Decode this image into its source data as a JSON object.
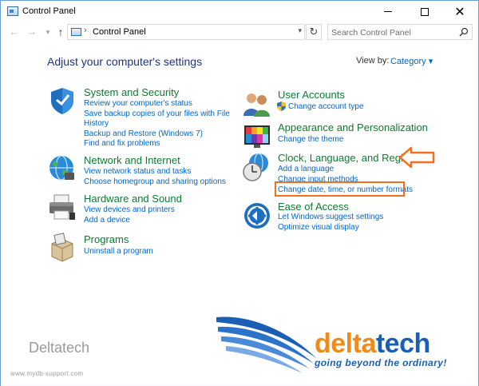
{
  "window": {
    "title": "Control Panel"
  },
  "addressbar": {
    "breadcrumb": "Control Panel",
    "separator": "›",
    "search_placeholder": "Search Control Panel"
  },
  "main": {
    "heading": "Adjust your computer's settings",
    "view_by_label": "View by:",
    "view_by_value": "Category ▾"
  },
  "categories": {
    "system": {
      "title": "System and Security",
      "links": [
        "Review your computer's status",
        "Save backup copies of your files with File",
        "History",
        "Backup and Restore (Windows 7)",
        "Find and fix problems"
      ]
    },
    "network": {
      "title": "Network and Internet",
      "links": [
        "View network status and tasks",
        "Choose homegroup and sharing options"
      ]
    },
    "hardware": {
      "title": "Hardware and Sound",
      "links": [
        "View devices and printers",
        "Add a device"
      ]
    },
    "programs": {
      "title": "Programs",
      "links": [
        "Uninstall a program"
      ]
    },
    "users": {
      "title": "User Accounts",
      "links": [
        "Change account type"
      ]
    },
    "appearance": {
      "title": "Appearance and Personalization",
      "links": [
        "Change the theme"
      ]
    },
    "clock": {
      "title": "Clock, Language, and Region",
      "links": [
        "Add a language",
        "Change input methods",
        "Change date, time, or number formats"
      ]
    },
    "ease": {
      "title": "Ease of Access",
      "links": [
        "Let Windows suggest settings",
        "Optimize visual display"
      ]
    }
  },
  "watermark": {
    "text": "Deltatech",
    "url": "www.mydb-support.com",
    "logo_part1": "delta",
    "logo_part2": "tech",
    "tagline": "going beyond the ordinary!"
  },
  "colors": {
    "category_title": "#0a7c2f",
    "link": "#0066cc",
    "heading": "#1e3287",
    "highlight": "#f26f21",
    "logo_orange": "#f08a18",
    "logo_blue": "#1a5fb4"
  },
  "icons": [
    "app-icon",
    "back-arrow-icon",
    "forward-arrow-icon",
    "up-arrow-icon",
    "refresh-icon",
    "search-icon",
    "shield-icon",
    "globe-network-icon",
    "printer-icon",
    "programs-box-icon",
    "users-icon",
    "uac-shield-icon",
    "palette-icon",
    "clock-globe-icon",
    "ease-of-access-icon",
    "orange-arrow-icon"
  ]
}
